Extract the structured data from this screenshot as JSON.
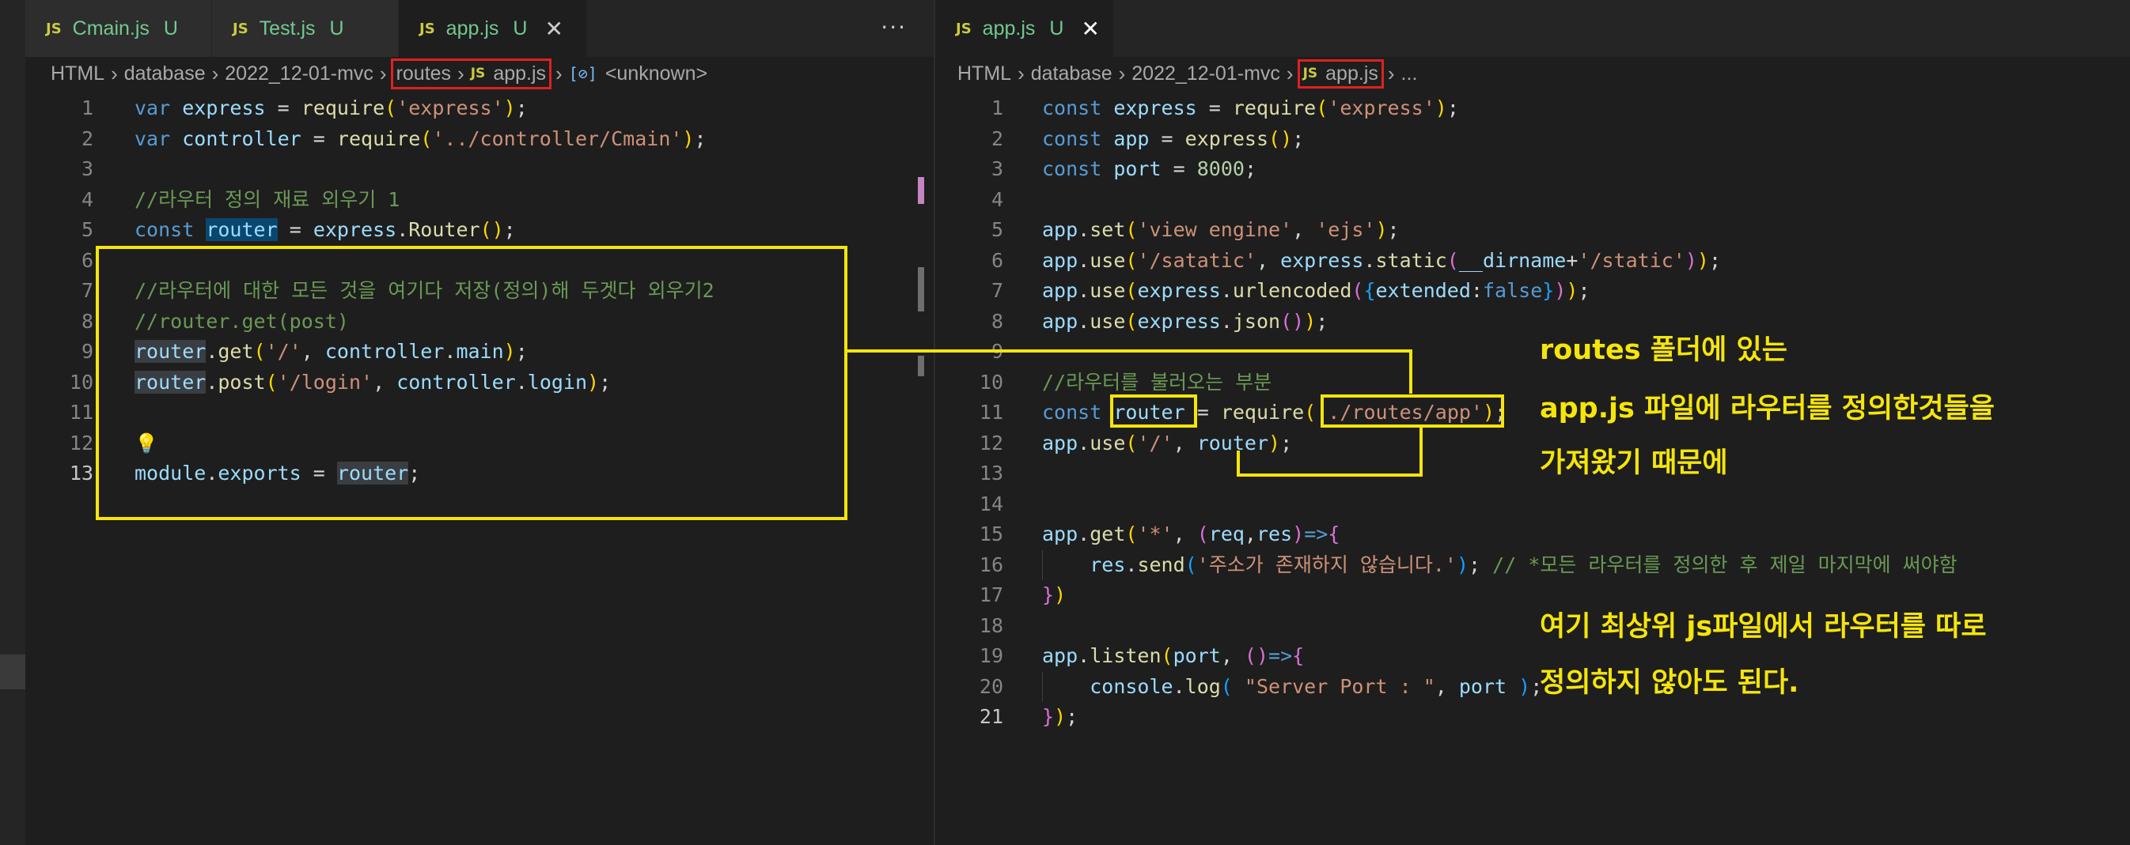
{
  "left": {
    "tabs": [
      {
        "label": "Cmain.js",
        "status": "U"
      },
      {
        "label": "Test.js",
        "status": "U"
      },
      {
        "label": "app.js",
        "status": "U",
        "active": true
      }
    ],
    "more": "···",
    "breadcrumbs": [
      "HTML",
      "database",
      "2022_12-01-mvc",
      "routes",
      "app.js",
      "<unknown>"
    ],
    "lines": [
      {
        "n": "1",
        "html": "<span class=\"kw\">var</span> <span class=\"var\">express</span> <span class=\"pn\">=</span> <span class=\"fn\">require</span><span class=\"pa1\">(</span><span class=\"str\">'express'</span><span class=\"pa1\">)</span><span class=\"pn\">;</span>"
      },
      {
        "n": "2",
        "html": "<span class=\"kw\">var</span> <span class=\"var\">controller</span> <span class=\"pn\">=</span> <span class=\"fn\">require</span><span class=\"pa1\">(</span><span class=\"str\">'../controller/Cmain'</span><span class=\"pa1\">)</span><span class=\"pn\">;</span>"
      },
      {
        "n": "3",
        "html": ""
      },
      {
        "n": "4",
        "html": "<span class=\"cm\">//라우터 정의 재료 외우기 1</span>"
      },
      {
        "n": "5",
        "html": "<span class=\"kw\">const</span> <span class=\"var hl\">router</span> <span class=\"pn\">=</span> <span class=\"var\">express</span><span class=\"pn\">.</span><span class=\"fn\">Router</span><span class=\"pa1\">()</span><span class=\"pn\">;</span>"
      },
      {
        "n": "6",
        "html": ""
      },
      {
        "n": "7",
        "html": "<span class=\"cm\">//라우터에 대한 모든 것을 여기다 저장(정의)해 두겟다 외우기2</span>"
      },
      {
        "n": "8",
        "html": "<span class=\"cm\">//router.get(post)</span>"
      },
      {
        "n": "9",
        "html": "<span class=\"var hlg\">router</span><span class=\"pn\">.</span><span class=\"fn\">get</span><span class=\"pa1\">(</span><span class=\"str\">'/'</span><span class=\"pn\">, </span><span class=\"var\">controller</span><span class=\"pn\">.</span><span class=\"var\">main</span><span class=\"pa1\">)</span><span class=\"pn\">;</span>"
      },
      {
        "n": "10",
        "html": "<span class=\"var hlg\">router</span><span class=\"pn\">.</span><span class=\"fn\">post</span><span class=\"pa1\">(</span><span class=\"str\">'/login'</span><span class=\"pn\">, </span><span class=\"var\">controller</span><span class=\"pn\">.</span><span class=\"var\">login</span><span class=\"pa1\">)</span><span class=\"pn\">;</span>"
      },
      {
        "n": "11",
        "html": ""
      },
      {
        "n": "12",
        "html": "<span class=\"bulb\">💡</span>"
      },
      {
        "n": "13",
        "html": "<span class=\"var\">module</span><span class=\"pn\">.</span><span class=\"var\">exports</span> <span class=\"pn\">=</span> <span class=\"var hlg\">router</span><span class=\"pn\">;</span>",
        "current": true
      }
    ]
  },
  "right": {
    "tabs": [
      {
        "label": "app.js",
        "status": "U",
        "active": true
      }
    ],
    "breadcrumbs": [
      "HTML",
      "database",
      "2022_12-01-mvc",
      "app.js",
      "..."
    ],
    "lines": [
      {
        "n": "1",
        "html": "<span class=\"kw\">const</span> <span class=\"var\">express</span> <span class=\"pn\">=</span> <span class=\"fn\">require</span><span class=\"pa1\">(</span><span class=\"str\">'express'</span><span class=\"pa1\">)</span><span class=\"pn\">;</span>"
      },
      {
        "n": "2",
        "html": "<span class=\"kw\">const</span> <span class=\"var\">app</span> <span class=\"pn\">=</span> <span class=\"fn\">express</span><span class=\"pa1\">()</span><span class=\"pn\">;</span>"
      },
      {
        "n": "3",
        "html": "<span class=\"kw\">const</span> <span class=\"var\">port</span> <span class=\"pn\">=</span> <span class=\"num\">8000</span><span class=\"pn\">;</span>"
      },
      {
        "n": "4",
        "html": ""
      },
      {
        "n": "5",
        "html": "<span class=\"var\">app</span><span class=\"pn\">.</span><span class=\"fn\">set</span><span class=\"pa1\">(</span><span class=\"str\">'view engine'</span><span class=\"pn\">, </span><span class=\"str\">'ejs'</span><span class=\"pa1\">)</span><span class=\"pn\">;</span>"
      },
      {
        "n": "6",
        "html": "<span class=\"var\">app</span><span class=\"pn\">.</span><span class=\"fn\">use</span><span class=\"pa1\">(</span><span class=\"str\">'/satatic'</span><span class=\"pn\">, </span><span class=\"var\">express</span><span class=\"pn\">.</span><span class=\"fn\">static</span><span class=\"pa2\">(</span><span class=\"var\">__dirname</span><span class=\"pn\">+</span><span class=\"str\">'/static'</span><span class=\"pa2\">)</span><span class=\"pa1\">)</span><span class=\"pn\">;</span>"
      },
      {
        "n": "7",
        "html": "<span class=\"var\">app</span><span class=\"pn\">.</span><span class=\"fn\">use</span><span class=\"pa1\">(</span><span class=\"var\">express</span><span class=\"pn\">.</span><span class=\"fn\">urlencoded</span><span class=\"pa2\">(</span><span class=\"pa3\">{</span><span class=\"var\">extended</span><span class=\"pn\">:</span><span class=\"kw\">false</span><span class=\"pa3\">}</span><span class=\"pa2\">)</span><span class=\"pa1\">)</span><span class=\"pn\">;</span>"
      },
      {
        "n": "8",
        "html": "<span class=\"var\">app</span><span class=\"pn\">.</span><span class=\"fn\">use</span><span class=\"pa1\">(</span><span class=\"var\">express</span><span class=\"pn\">.</span><span class=\"fn\">json</span><span class=\"pa2\">()</span><span class=\"pa1\">)</span><span class=\"pn\">;</span>"
      },
      {
        "n": "9",
        "html": ""
      },
      {
        "n": "10",
        "html": "<span class=\"cm\">//라우터를 불러오는 부분</span>"
      },
      {
        "n": "11",
        "html": "<span class=\"kw\">const</span> <span class=\"var\">router</span> <span class=\"pn\">=</span> <span class=\"fn\">require</span><span class=\"pa1\">(</span><span class=\"str\">'./routes/app'</span><span class=\"pa1\">)</span><span class=\"pn\">;</span>"
      },
      {
        "n": "12",
        "html": "<span class=\"var\">app</span><span class=\"pn\">.</span><span class=\"fn\">use</span><span class=\"pa1\">(</span><span class=\"str\">'/'</span><span class=\"pn\">, </span><span class=\"var\">router</span><span class=\"pa1\">)</span><span class=\"pn\">;</span>"
      },
      {
        "n": "13",
        "html": ""
      },
      {
        "n": "14",
        "html": ""
      },
      {
        "n": "15",
        "html": "<span class=\"var\">app</span><span class=\"pn\">.</span><span class=\"fn\">get</span><span class=\"pa1\">(</span><span class=\"str\">'*'</span><span class=\"pn\">, </span><span class=\"pa2\">(</span><span class=\"var\">req</span><span class=\"pn\">,</span><span class=\"var\">res</span><span class=\"pa2\">)</span><span class=\"kw\">=&gt;</span><span class=\"pa2\">{</span>"
      },
      {
        "n": "16",
        "html": "    <span class=\"var\">res</span><span class=\"pn\">.</span><span class=\"fn\">send</span><span class=\"pa3\">(</span><span class=\"str\">'주소가 존재하지 않습니다.'</span><span class=\"pa3\">)</span><span class=\"pn\">;</span> <span class=\"cm\">// *모든 라우터를 정의한 후 제일 마지막에 써야함</span>",
        "guide": true
      },
      {
        "n": "17",
        "html": "<span class=\"pa2\">}</span><span class=\"pa1\">)</span>"
      },
      {
        "n": "18",
        "html": ""
      },
      {
        "n": "19",
        "html": "<span class=\"var\">app</span><span class=\"pn\">.</span><span class=\"fn\">listen</span><span class=\"pa1\">(</span><span class=\"var\">port</span><span class=\"pn\">, </span><span class=\"pa2\">()</span><span class=\"kw\">=&gt;</span><span class=\"pa2\">{</span>"
      },
      {
        "n": "20",
        "html": "    <span class=\"var\">console</span><span class=\"pn\">.</span><span class=\"fn\">log</span><span class=\"pa3\">(</span> <span class=\"str\">\"Server Port : \"</span><span class=\"pn\">, </span><span class=\"var\">port</span> <span class=\"pa3\">)</span><span class=\"pn\">;</span>",
        "guide": true
      },
      {
        "n": "21",
        "html": "<span class=\"pa2\">}</span><span class=\"pa1\">)</span><span class=\"pn\">;</span>",
        "current": true
      }
    ]
  },
  "annotations": {
    "note1_line1": "routes 폴더에 있는",
    "note1_line2": "app.js 파일에 라우터를 정의한것들을",
    "note1_line3": "가져왔기 때문에",
    "note2_line1": "여기 최상위 js파일에서 라우터를 따로",
    "note2_line2": "정의하지 않아도 된다."
  },
  "colors": {
    "annotation": "#f5e50a",
    "breadcrumb_highlight": "#e02020",
    "untracked": "#73c991",
    "js_icon": "#cbcb41"
  }
}
